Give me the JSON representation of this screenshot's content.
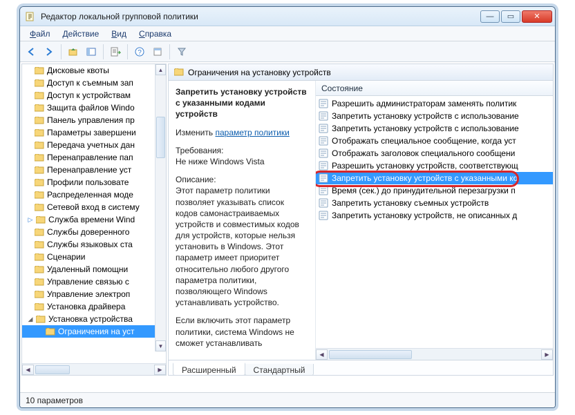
{
  "window": {
    "title": "Редактор локальной групповой политики"
  },
  "menus": {
    "file": "Файл",
    "action": "Действие",
    "view": "Вид",
    "help": "Справка",
    "file_u": "Ф",
    "action_u": "Д",
    "view_u": "В",
    "help_u": "С"
  },
  "tree": {
    "items": [
      "Дисковые квоты",
      "Доступ к съемным зап",
      "Доступ к устройствам",
      "Защита файлов Windo",
      "Панель управления пр",
      "Параметры завершени",
      "Передача учетных дан",
      "Перенаправление пап",
      "Перенаправление уст",
      "Профили пользовате",
      "Распределенная моде",
      "Сетевой вход в систему",
      "Служба времени Wind",
      "Службы доверенного",
      "Службы языковых ста",
      "Сценарии",
      "Удаленный помощни",
      "Управление связью с",
      "Управление электроп",
      "Установка драйвера",
      "Установка устройства",
      "Ограничения на уст"
    ],
    "selected": 21
  },
  "header_path": "Ограничения на установку устройств",
  "desc": {
    "heading": "Запретить установку устройств с указанными кодами устройств",
    "edit_label": "Изменить",
    "edit_link": "параметр политики",
    "req_label": "Требования:",
    "req_value": "Не ниже Windows Vista",
    "desc_label": "Описание:",
    "desc_text1": "Этот параметр политики позволяет указывать список кодов самонастраиваемых устройств и совместимых кодов для устройств, которые нельзя установить в Windows. Этот параметр имеет приоритет относительно любого другого параметра политики, позволяющего Windows устанавливать устройство.",
    "desc_text2": "Если включить этот параметр политики, система Windows не сможет устанавливать"
  },
  "list": {
    "header": "Состояние",
    "items": [
      "Разрешить администраторам заменять политик",
      "Запретить установку устройств с использование",
      "Запретить установку устройств с использование",
      "Отображать специальное сообщение, когда уст",
      "Отображать заголовок специального сообщени",
      "Разрешить установку устройств, соответствующ",
      "Запретить установку устройств с указанными ко",
      "Время (сек.) до принудительной перезагрузки п",
      "Запретить установку съемных устройств",
      "Запретить установку устройств, не описанных д"
    ],
    "selected": 6
  },
  "tabs": {
    "extended": "Расширенный",
    "standard": "Стандартный"
  },
  "status": "10 параметров"
}
